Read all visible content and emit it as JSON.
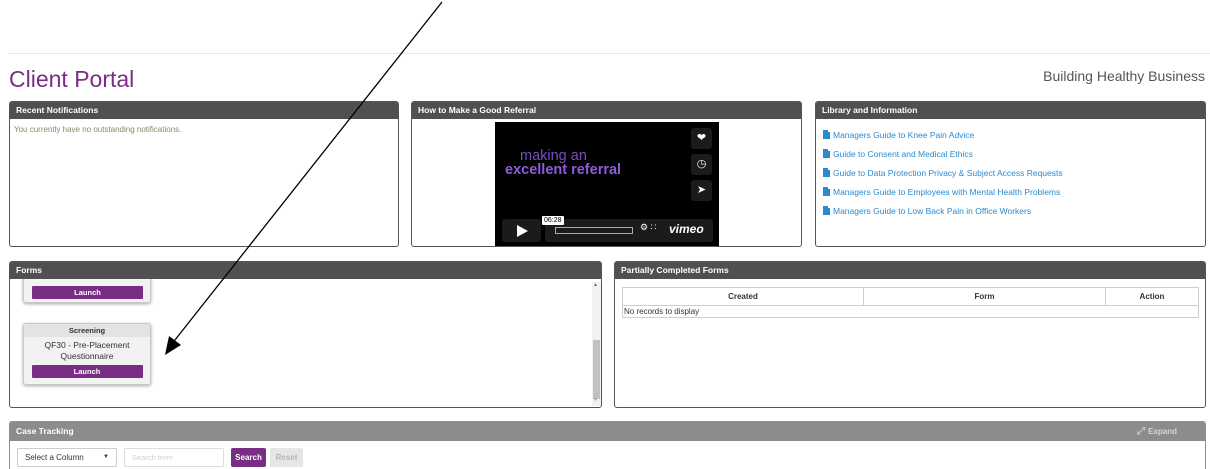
{
  "header": {
    "title": "Client Portal",
    "tagline": "Building Healthy Business"
  },
  "notifications": {
    "title": "Recent Notifications",
    "message": "You currently have no outstanding notifications."
  },
  "video": {
    "title": "How to Make a Good Referral",
    "line1": "making an",
    "line2": "excellent referral",
    "timestamp": "06:28",
    "player_brand": "vimeo",
    "side_icons": [
      "heart-icon",
      "clock-icon",
      "send-icon"
    ],
    "control_icons": [
      "play-icon",
      "settings-icon",
      "fullscreen-icon"
    ]
  },
  "library": {
    "title": "Library and Information",
    "items": [
      {
        "label": "Managers Guide to Knee Pain Advice"
      },
      {
        "label": "Guide to Consent and Medical Ethics"
      },
      {
        "label": "Guide to Data Protection Privacy & Subject Access Requests"
      },
      {
        "label": "Managers Guide to Employees with Mental Health Problems"
      },
      {
        "label": "Managers Guide to Low Back Pain in Office Workers"
      }
    ]
  },
  "forms": {
    "title": "Forms",
    "cards": [
      {
        "launch_label": "Launch"
      },
      {
        "category": "Screening",
        "name": "QF30 - Pre-Placement Questionnaire",
        "launch_label": "Launch"
      }
    ]
  },
  "partial_forms": {
    "title": "Partially Completed Forms",
    "columns": [
      "Created",
      "Form",
      "Action"
    ],
    "empty_message": "No records to display"
  },
  "case_tracking": {
    "title": "Case Tracking",
    "expand_label": "Expand",
    "column_select": "Select a Column",
    "search_placeholder": "Search term",
    "search_label": "Search",
    "reset_label": "Reset"
  },
  "colors": {
    "brand_purple": "#7a2d84",
    "panel_header": "#505050",
    "link_blue": "#2a8ad0"
  }
}
